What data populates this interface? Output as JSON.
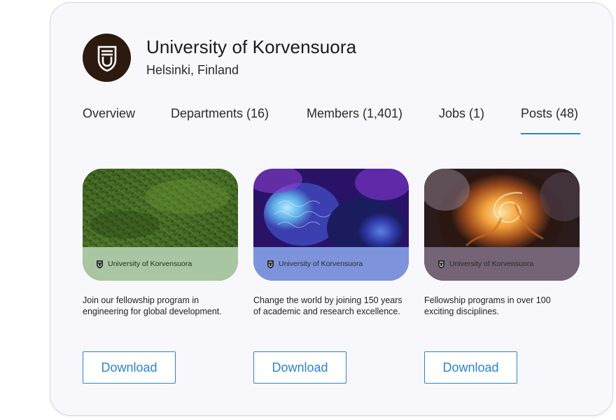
{
  "org": {
    "name": "University of Korvensuora",
    "location": "Helsinki, Finland",
    "logo_color": "#2c1a0f"
  },
  "tabs": [
    {
      "label": "Overview"
    },
    {
      "label": "Departments (16)"
    },
    {
      "label": "Members (1,401)"
    },
    {
      "label": "Jobs (1)"
    },
    {
      "label": "Posts (48)",
      "active": true
    }
  ],
  "posts": [
    {
      "image": "green-moss",
      "band_label": "University of Korvensuora",
      "band_color": "#a9c6a2",
      "description": "Join our fellowship program in engineering for global development.",
      "button_label": "Download"
    },
    {
      "image": "coral-reef",
      "band_label": "University of Korvensuora",
      "band_color": "#7d94dc",
      "description": "Change the world by joining 150 years of academic and research excellence.",
      "button_label": "Download"
    },
    {
      "image": "fire-swirl",
      "band_label": "University of Korvensuora",
      "band_color": "#746476",
      "description": "Fellowship programs in over 100 exciting disciplines.",
      "button_label": "Download"
    }
  ],
  "accent_color": "#2b86c8"
}
